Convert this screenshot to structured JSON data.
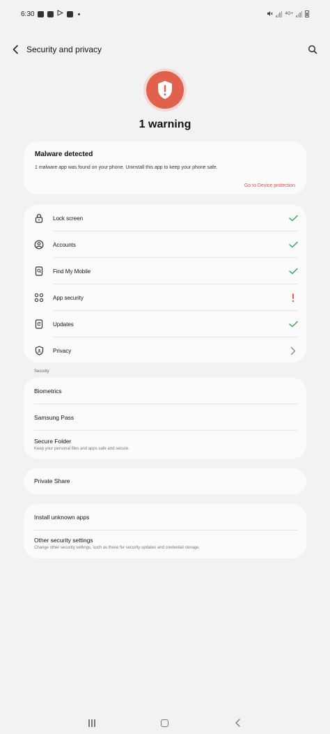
{
  "status_bar": {
    "time": "6:30",
    "network_label": "4G+",
    "icons": [
      "gallery-icon",
      "youtube-icon",
      "play-store-icon",
      "v-app-icon",
      "mute-icon",
      "wifi-icon",
      "signal-icon",
      "battery-icon"
    ]
  },
  "header": {
    "title": "Security and privacy",
    "back_icon": "back-arrow-icon",
    "search_icon": "search-icon"
  },
  "hero": {
    "icon": "shield-alert-icon",
    "title": "1 warning"
  },
  "malware": {
    "title": "Malware detected",
    "description": "1 malware app was found on your phone. Uninstall this app to keep your phone safe.",
    "link": "Go to Device protection"
  },
  "checks": [
    {
      "label": "Lock screen",
      "icon": "lock-icon",
      "status": "ok"
    },
    {
      "label": "Accounts",
      "icon": "account-icon",
      "status": "ok"
    },
    {
      "label": "Find My Mobile",
      "icon": "find-mobile-icon",
      "status": "ok"
    },
    {
      "label": "App security",
      "icon": "app-grid-icon",
      "status": "warning"
    },
    {
      "label": "Updates",
      "icon": "update-icon",
      "status": "ok"
    },
    {
      "label": "Privacy",
      "icon": "privacy-shield-icon",
      "status": "chevron"
    }
  ],
  "security_section": {
    "header": "Security",
    "items": [
      {
        "label": "Biometrics"
      },
      {
        "label": "Samsung Pass"
      },
      {
        "label": "Secure Folder",
        "subtitle": "Keep your personal files and apps safe and secure."
      }
    ]
  },
  "private_share": {
    "label": "Private Share"
  },
  "other_items": [
    {
      "label": "Install unknown apps"
    },
    {
      "label": "Other security settings",
      "subtitle": "Change other security settings, such as those for security updates and credential storage."
    }
  ],
  "colors": {
    "background": "#f2f2f2",
    "card": "#fbfbfb",
    "alert_red": "#e0614c",
    "link_red": "#d9533f",
    "check_green": "#3aa655"
  }
}
